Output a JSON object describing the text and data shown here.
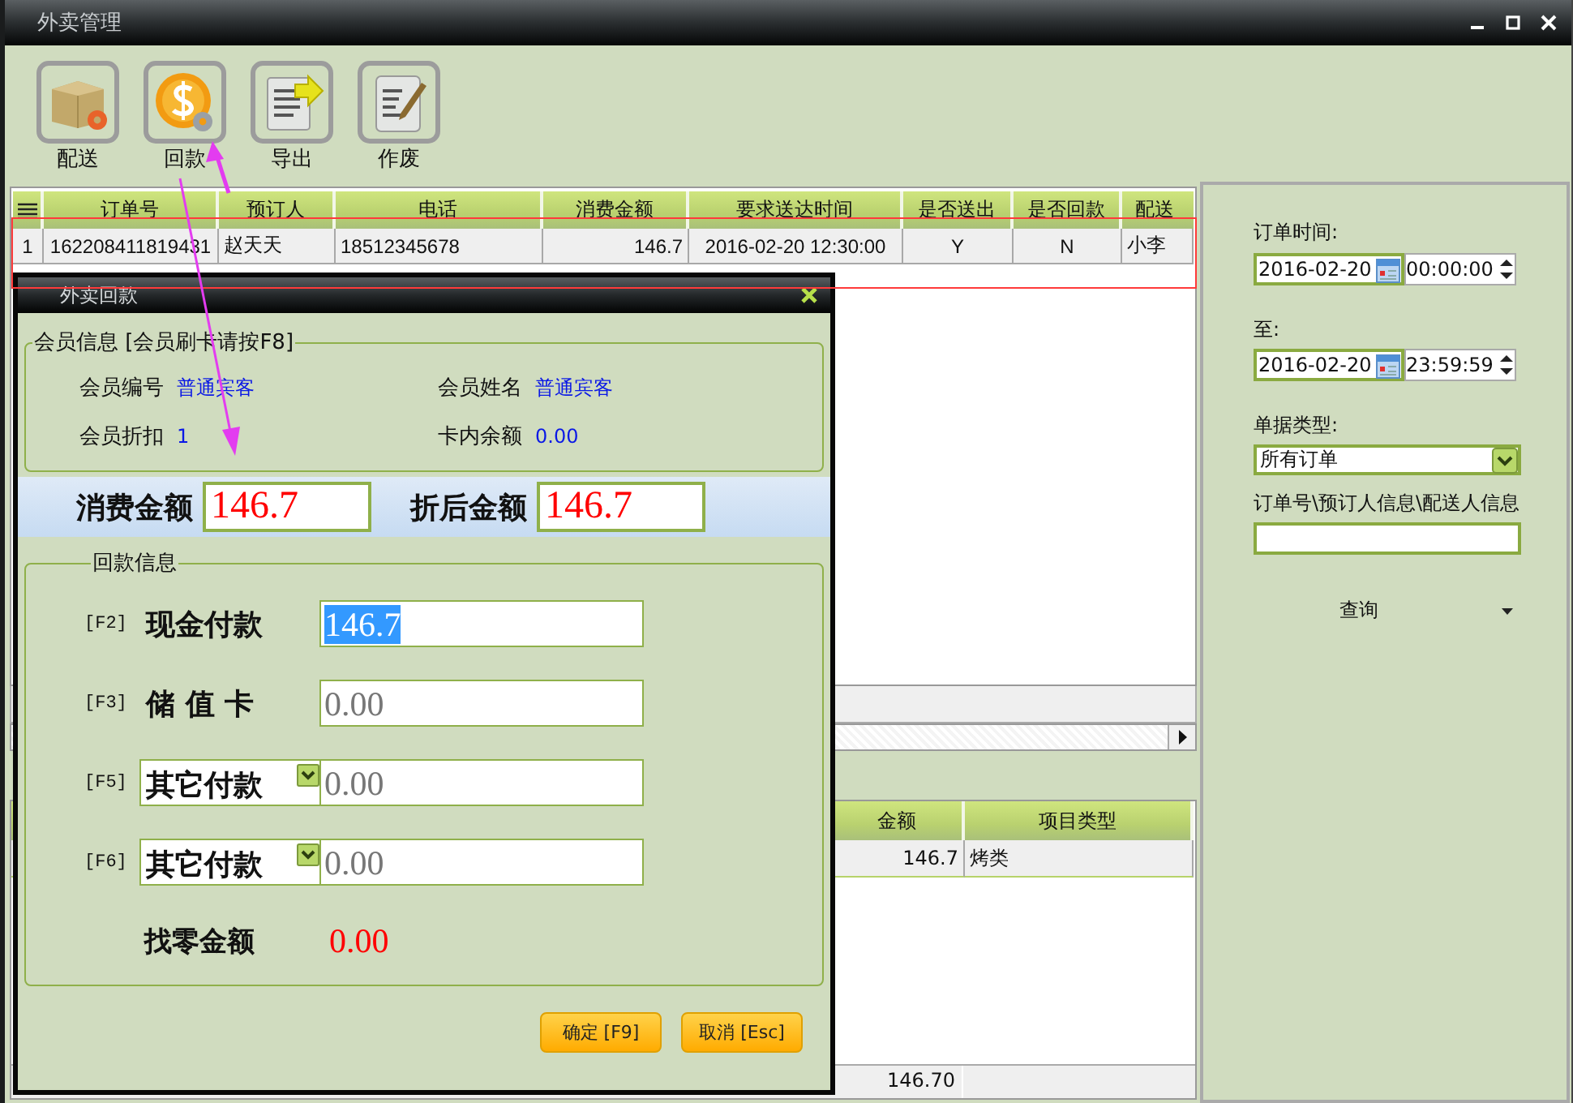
{
  "window": {
    "title": "外卖管理"
  },
  "toolbar": [
    {
      "label": "配送"
    },
    {
      "label": "回款"
    },
    {
      "label": "导出"
    },
    {
      "label": "作废"
    }
  ],
  "orders_table": {
    "columns": [
      "订单号",
      "预订人",
      "电话",
      "消费金额",
      "要求送达时间",
      "是否送出",
      "是否回款",
      "配送"
    ],
    "rows": [
      {
        "number": "1",
        "cells": [
          "162208411819431",
          "赵天天",
          "18512345678",
          "146.7",
          "2016-02-20 12:30:00",
          "Y",
          "N",
          "小李"
        ]
      }
    ]
  },
  "detail_table": {
    "columns": [
      "金额",
      "项目类型"
    ],
    "rows": [
      [
        "146.7",
        "烤类"
      ]
    ],
    "footer": [
      "146.70"
    ]
  },
  "filter_panel": {
    "order_time_label": "订单时间:",
    "from": {
      "date": "2016-02-20",
      "time": "00:00:00"
    },
    "to_label": "至:",
    "to": {
      "date": "2016-02-20",
      "time": "23:59:59"
    },
    "type_label": "单据类型:",
    "type_value": "所有订单",
    "search_label": "订单号\\预订人信息\\配送人信息",
    "query_button": "查询"
  },
  "dialog": {
    "title": "外卖回款",
    "member_group": {
      "title": "会员信息 [会员刷卡请按F8]",
      "fields": [
        {
          "label": "会员编号",
          "value": "普通宾客"
        },
        {
          "label": "会员姓名",
          "value": "普通宾客"
        },
        {
          "label": "会员折扣",
          "value": "1"
        },
        {
          "label": "卡内余额",
          "value": "0.00"
        }
      ]
    },
    "amounts": [
      {
        "label": "消费金额",
        "value": "146.7"
      },
      {
        "label": "折后金额",
        "value": "146.7"
      }
    ],
    "payment_group": {
      "title": "回款信息",
      "payments": [
        {
          "kind": "label",
          "key": "[F2]",
          "label": "现金付款",
          "value": "146.7",
          "text_selected": true
        },
        {
          "kind": "label",
          "key": "[F3]",
          "label": "储 值 卡",
          "value": "0.00",
          "text_selected": false
        },
        {
          "kind": "dropdown",
          "key": "[F5]",
          "label": "其它付款",
          "value": "0.00",
          "text_selected": false
        },
        {
          "kind": "dropdown",
          "key": "[F6]",
          "label": "其它付款",
          "value": "0.00",
          "text_selected": false
        }
      ],
      "change_label": "找零金额",
      "change_value": "0.00"
    },
    "buttons": [
      "确定 [F9]",
      "取消 [Esc]"
    ]
  }
}
